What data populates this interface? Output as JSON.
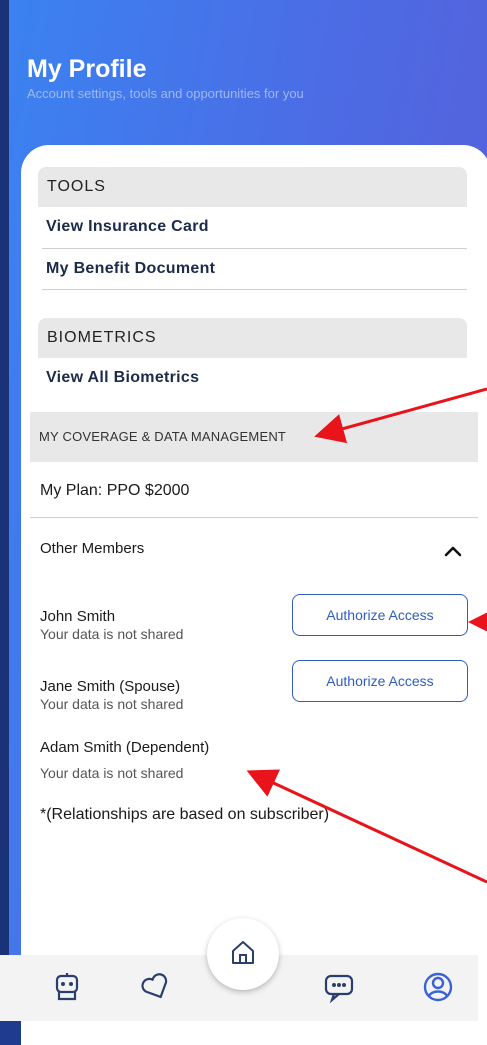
{
  "header": {
    "title": "My Profile",
    "subtitle": "Account settings, tools and opportunities for you"
  },
  "tools": {
    "heading": "TOOLS",
    "items": [
      "View Insurance Card",
      "My Benefit Document"
    ]
  },
  "biometrics": {
    "heading": "BIOMETRICS",
    "items": [
      "View All Biometrics"
    ]
  },
  "coverage": {
    "heading": "MY COVERAGE & DATA MANAGEMENT",
    "plan": "My Plan: PPO $2000",
    "other_members_label": "Other Members",
    "members": [
      {
        "name": "John Smith",
        "status": "Your data is not shared",
        "button": "Authorize Access"
      },
      {
        "name": "Jane Smith (Spouse)",
        "status": "Your data is not shared",
        "button": "Authorize Access"
      },
      {
        "name": "Adam Smith (Dependent)",
        "status": "Your data is not shared"
      }
    ],
    "footnote": "*(Relationships are based on subscriber)"
  },
  "nav": {
    "items": [
      "coach-icon",
      "heart-tag-icon",
      "home-icon",
      "chat-icon",
      "profile-icon"
    ],
    "active": "profile-icon"
  },
  "colors": {
    "header_gradient_start": "#3b82f0",
    "header_gradient_end": "#5a5bd6",
    "accent": "#2f5dbf",
    "annotation_arrow": "#e8131b"
  }
}
